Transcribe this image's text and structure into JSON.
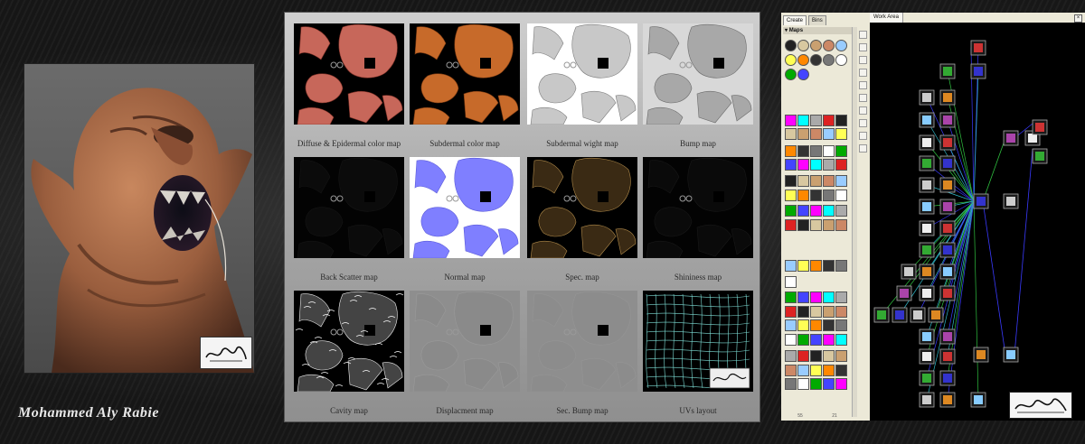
{
  "author": "Mohammed Aly Rabie",
  "maps_board": {
    "tiles": [
      {
        "caption": "Diffuse & Epidermal color map",
        "style": "diffuse"
      },
      {
        "caption": "Subdermal color map",
        "style": "subdermal"
      },
      {
        "caption": "Subdermal wight map",
        "style": "weight"
      },
      {
        "caption": "Bump map",
        "style": "bump"
      },
      {
        "caption": "Back Scatter map",
        "style": "backscatter"
      },
      {
        "caption": "Normal map",
        "style": "normal"
      },
      {
        "caption": "Spec. map",
        "style": "spec"
      },
      {
        "caption": "Shininess map",
        "style": "shininess"
      },
      {
        "caption": "Cavity map",
        "style": "cavity"
      },
      {
        "caption": "Displacment map",
        "style": "displace"
      },
      {
        "caption": "Sec. Bump map",
        "style": "secbump"
      },
      {
        "caption": "UVs layout",
        "style": "uv"
      }
    ]
  },
  "editor": {
    "tabs": [
      {
        "label": "Create"
      },
      {
        "label": "Bins"
      }
    ],
    "palette_header": "Maps",
    "palette_status": [
      "55",
      "21"
    ],
    "work_area_title": "Work Area",
    "close_glyph": "×"
  },
  "colors": {
    "diffuse": "#c7675a",
    "subdermal": "#c76a2a",
    "normal": "#7f7fff",
    "spec": "#b08a4a",
    "link_blue": "#3a3aff",
    "link_green": "#2fbf3f",
    "link_cyan": "#2fb7c7"
  }
}
